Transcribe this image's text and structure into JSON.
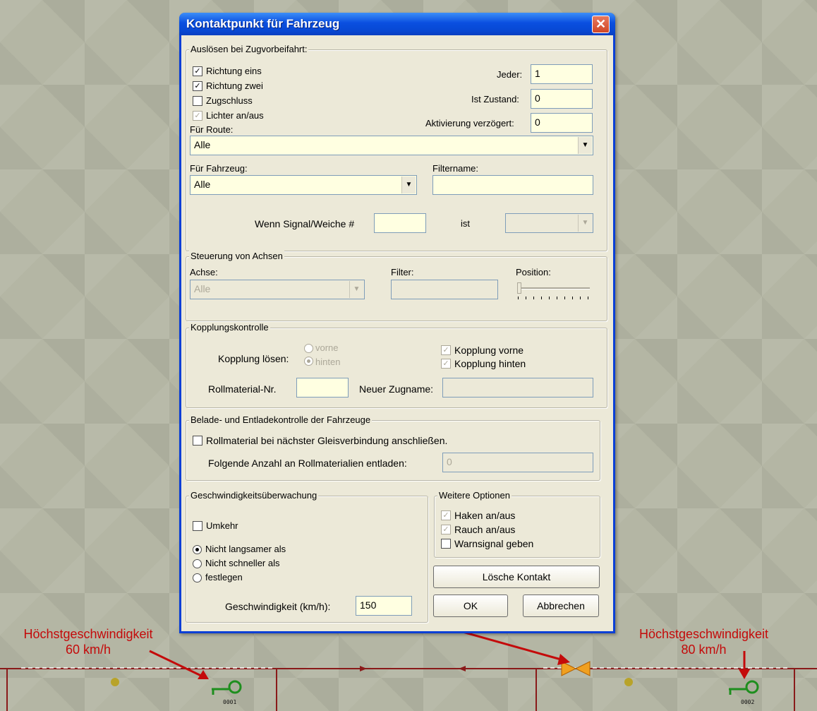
{
  "scene": {
    "left_label": {
      "line1": "Höchstgeschwindigkeit",
      "line2": "60 km/h"
    },
    "right_label": {
      "line1": "Höchstgeschwindigkeit",
      "line2": "80 km/h"
    },
    "marker1": "0001",
    "marker2": "0002",
    "annotation_color": "#c40a0a"
  },
  "dialog": {
    "title": "Kontaktpunkt für Fahrzeug",
    "close_icon": "close-icon",
    "trigger": {
      "legend": "Auslösen bei Zugvorbeifahrt:",
      "richtung_eins": {
        "label": "Richtung eins",
        "checked": true
      },
      "richtung_zwei": {
        "label": "Richtung zwei",
        "checked": true
      },
      "zugschluss": {
        "label": "Zugschluss",
        "checked": false
      },
      "lichter": {
        "label": "Lichter an/aus",
        "checked": true,
        "disabled": true
      },
      "jeder_label": "Jeder:",
      "jeder_value": "1",
      "ist_zustand_label": "Ist Zustand:",
      "ist_zustand_value": "0",
      "aktivierung_label": "Aktivierung verzögert:",
      "aktivierung_value": "0",
      "route_label": "Für Route:",
      "route_value": "Alle",
      "fahrzeug_label": "Für Fahrzeug:",
      "fahrzeug_value": "Alle",
      "filtername_label": "Filtername:",
      "filtername_value": "",
      "wenn_signal_label": "Wenn Signal/Weiche #",
      "wenn_signal_value": "",
      "ist_label": "ist",
      "ist_value": ""
    },
    "axles": {
      "legend": "Steuerung von Achsen",
      "achse_label": "Achse:",
      "achse_value": "Alle",
      "filter_label": "Filter:",
      "filter_value": "",
      "position_label": "Position:",
      "position_value": 0
    },
    "coupling": {
      "legend": "Kopplungskontrolle",
      "loesen_label": "Kopplung lösen:",
      "vorne_radio": "vorne",
      "hinten_radio": "hinten",
      "kopplung_vorne": "Kopplung vorne",
      "kopplung_hinten": "Kopplung hinten",
      "rollmaterial_label": "Rollmaterial-Nr.",
      "rollmaterial_value": "",
      "neuer_zugname_label": "Neuer Zugname:",
      "neuer_zugname_value": ""
    },
    "loading": {
      "legend": "Belade- und Entladekontrolle der Fahrzeuge",
      "anschliessen_label": "Rollmaterial bei nächster Gleisverbindung anschließen.",
      "entladen_label": "Folgende Anzahl an Rollmaterialien entladen:",
      "entladen_value": "0"
    },
    "speed": {
      "legend": "Geschwindigkeitsüberwachung",
      "umkehr_label": "Umkehr",
      "nicht_langsamer": "Nicht langsamer als",
      "nicht_schneller": "Nicht schneller als",
      "festlegen": "festlegen",
      "geschwindigkeit_label": "Geschwindigkeit (km/h):",
      "geschwindigkeit_value": "150"
    },
    "options": {
      "legend": "Weitere Optionen",
      "haken": "Haken an/aus",
      "rauch": "Rauch an/aus",
      "warnsignal": "Warnsignal geben"
    },
    "buttons": {
      "loesche": "Lösche Kontakt",
      "ok": "OK",
      "abbrechen": "Abbrechen"
    }
  }
}
